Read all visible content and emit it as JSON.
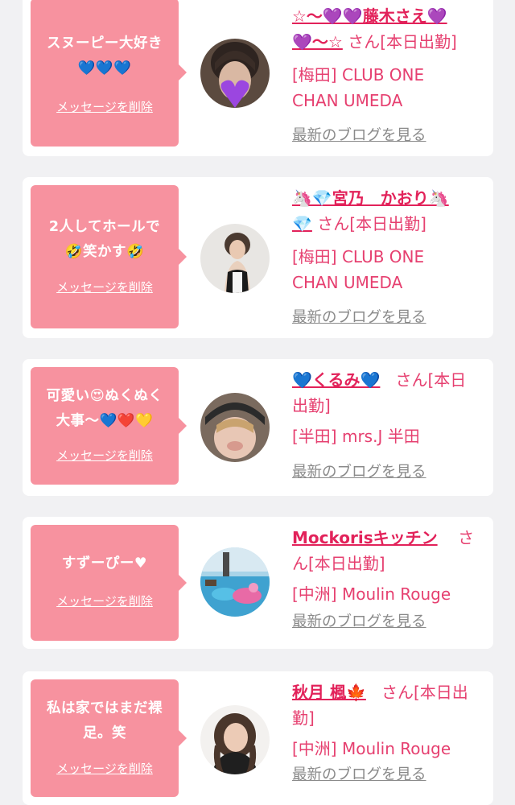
{
  "entries": [
    {
      "message_line1": "スヌーピー大好き",
      "message_line2": "💙💙💙",
      "delete_label": "メッセージを削除",
      "name_line1": "☆〜💜💜藤木さえ💜",
      "name_line2": "💜〜☆",
      "suffix": "さん[本日出勤]",
      "shop_line1": "[梅田] CLUB ONE",
      "shop_line2": "CHAN UMEDA",
      "blog_label": "最新のブログを見る"
    },
    {
      "message_line1": "2人してホールで",
      "message_line2": "🤣笑かす🤣",
      "delete_label": "メッセージを削除",
      "name_line1": "🦄💎宮乃　かおり🦄",
      "name_line2": "💎",
      "suffix": "さん[本日出勤]",
      "shop_line1": "[梅田] CLUB ONE",
      "shop_line2": "CHAN UMEDA",
      "blog_label": "最新のブログを見る"
    },
    {
      "message_line1": "可愛い😍ぬくぬく",
      "message_line2": "大事〜💙❤️💛",
      "delete_label": "メッセージを削除",
      "name_line1": "💙くるみ💙",
      "suffix_line1": "さん[本日",
      "suffix_line2": "出勤]",
      "shop_line1": "[半田] mrs.J 半田",
      "blog_label": "最新のブログを見る"
    },
    {
      "message_line1": "すずーぴー♥",
      "delete_label": "メッセージを削除",
      "name_line1": "Mockorisキッチン",
      "suffix_line1": "さ",
      "suffix_line2": "ん[本日出勤]",
      "shop_line1": "[中洲] Moulin Rouge",
      "blog_label": "最新のブログを見る"
    },
    {
      "message_line1": "私は家ではまだ裸",
      "message_line2": "足。笑",
      "delete_label": "メッセージを削除",
      "name_line1": "秋月 楓🍁",
      "suffix_line1": "さん[本日出",
      "suffix_line2": "勤]",
      "shop_line1": "[中洲] Moulin Rouge",
      "blog_label": "最新のブログを見る"
    }
  ],
  "colors": {
    "bubble": "#f7929f",
    "name": "#e2225a",
    "text": "#e64070",
    "link_gray": "#8a8a8a",
    "background": "#f1f1f3"
  }
}
